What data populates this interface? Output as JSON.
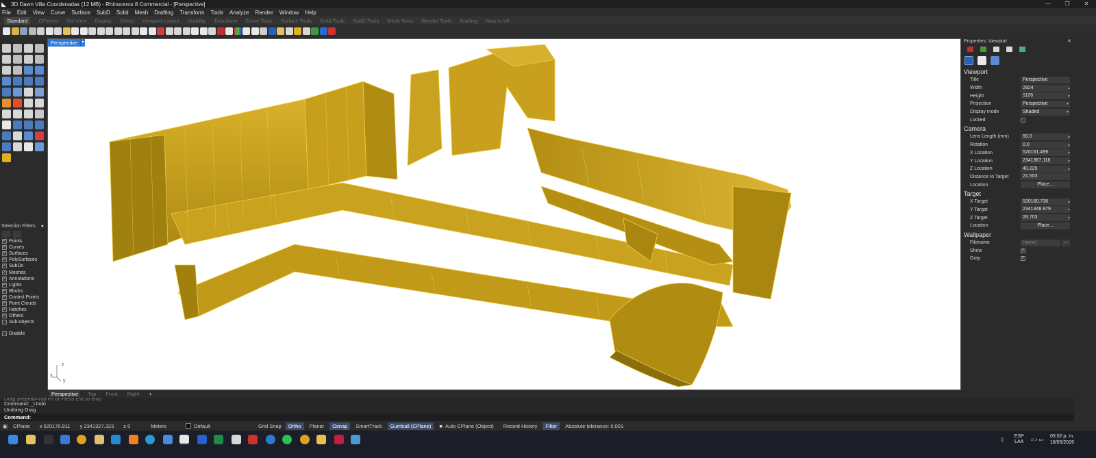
{
  "window": {
    "title": "3D Dawn Villa Coordenadas (12 MB) - Rhinoceros 8 Commercial - [Perspective]",
    "controls": [
      "—",
      "❐",
      "✕"
    ]
  },
  "menu": [
    "File",
    "Edit",
    "View",
    "Curve",
    "Surface",
    "SubD",
    "Solid",
    "Mesh",
    "Drafting",
    "Transform",
    "Tools",
    "Analyze",
    "Render",
    "Window",
    "Help"
  ],
  "toolbar_tabs": [
    "Standard",
    "CPlanes",
    "Set View",
    "Display",
    "Select",
    "Viewport Layout",
    "Visibility",
    "Transform",
    "Curve Tools",
    "Surface Tools",
    "Solid Tools",
    "SubD Tools",
    "Mesh Tools",
    "Render Tools",
    "Drafting",
    "New in V8"
  ],
  "toolbar_tabs_active": "Standard",
  "viewport": {
    "label": "Perspective",
    "axis_x": "x",
    "axis_y": "y",
    "axis_z": "z",
    "background": "#ffffff",
    "model_color": "#c8a21a",
    "edge_color": "#e8c43a",
    "shadow_color": "#8a6d0c"
  },
  "viewport_tabs": [
    "Perspective",
    "Top",
    "Front",
    "Right",
    "+"
  ],
  "viewport_tab_active": "Perspective",
  "selection_filters": {
    "title": "Selection Filters",
    "items": [
      {
        "label": "Points",
        "checked": true
      },
      {
        "label": "Curves",
        "checked": true
      },
      {
        "label": "Surfaces",
        "checked": true
      },
      {
        "label": "PolySurfaces",
        "checked": true
      },
      {
        "label": "SubDs",
        "checked": true
      },
      {
        "label": "Meshes",
        "checked": true
      },
      {
        "label": "Annotations",
        "checked": true
      },
      {
        "label": "Lights",
        "checked": true
      },
      {
        "label": "Blocks",
        "checked": true
      },
      {
        "label": "Control Points",
        "checked": true
      },
      {
        "label": "Point Clouds",
        "checked": true
      },
      {
        "label": "Hatches",
        "checked": true
      },
      {
        "label": "Others",
        "checked": true
      },
      {
        "label": "Sub-objects",
        "checked": false
      }
    ],
    "disable_label": "Disable"
  },
  "command": {
    "history": [
      "Command: _Undo",
      "Undoing Drag"
    ],
    "history_faint": "Drag (Repeat=Tap Fn or Press Esc to end)",
    "prompt": "Command:"
  },
  "status": {
    "cplane": "CPlane",
    "x": "x 520170.911",
    "y": "y 2341327.323",
    "z": "z 0",
    "units": "Meters",
    "layer": "Default",
    "grid_snap": "Grid Snap",
    "ortho": "Ortho",
    "planar": "Planar",
    "osnap": "Osnap",
    "smarttrack": "SmartTrack",
    "gumball": "Gumball (CPlane)",
    "auto_cplane": "Auto CPlane (Object)",
    "record_history": "Record History",
    "filter": "Filter",
    "tolerance": "Absolute tolerance: 0.001"
  },
  "properties": {
    "title": "Properties: Viewport",
    "viewport_section": "Viewport",
    "viewport_rows": [
      {
        "label": "Title",
        "value": "Perspective",
        "kind": "text"
      },
      {
        "label": "Width",
        "value": "2924",
        "kind": "spin"
      },
      {
        "label": "Height",
        "value": "1126",
        "kind": "spin"
      },
      {
        "label": "Projection",
        "value": "Perspective",
        "kind": "drop"
      },
      {
        "label": "Display mode",
        "value": "Shaded",
        "kind": "drop"
      },
      {
        "label": "Locked",
        "value": "",
        "kind": "check"
      }
    ],
    "camera_section": "Camera",
    "camera_rows": [
      {
        "label": "Lens Length (mm)",
        "value": "50.0",
        "kind": "spin"
      },
      {
        "label": "Rotation",
        "value": "0.0",
        "kind": "spin"
      },
      {
        "label": "X Location",
        "value": "520161.499",
        "kind": "spin"
      },
      {
        "label": "Y Location",
        "value": "2341367.118",
        "kind": "spin"
      },
      {
        "label": "Z Location",
        "value": "40.225",
        "kind": "spin"
      },
      {
        "label": "Distance to Target",
        "value": "21.503",
        "kind": "text"
      },
      {
        "label": "Location",
        "value": "Place...",
        "kind": "button"
      }
    ],
    "target_section": "Target",
    "target_rows": [
      {
        "label": "X Target",
        "value": "520160.738",
        "kind": "spin"
      },
      {
        "label": "Y Target",
        "value": "2341348.979",
        "kind": "spin"
      },
      {
        "label": "Z Target",
        "value": "28.703",
        "kind": "spin"
      },
      {
        "label": "Location",
        "value": "Place...",
        "kind": "button"
      }
    ],
    "wallpaper_section": "Wallpaper",
    "wallpaper_rows": [
      {
        "label": "Filename",
        "value": "(none)",
        "kind": "file"
      },
      {
        "label": "Show",
        "value": "✓",
        "kind": "checkon"
      },
      {
        "label": "Gray",
        "value": "✓",
        "kind": "checkon"
      }
    ]
  },
  "taskbar": {
    "lang_top": "ESP",
    "lang_bottom": "LAA",
    "time": "05:02 p. m.",
    "date": "18/05/2026"
  }
}
